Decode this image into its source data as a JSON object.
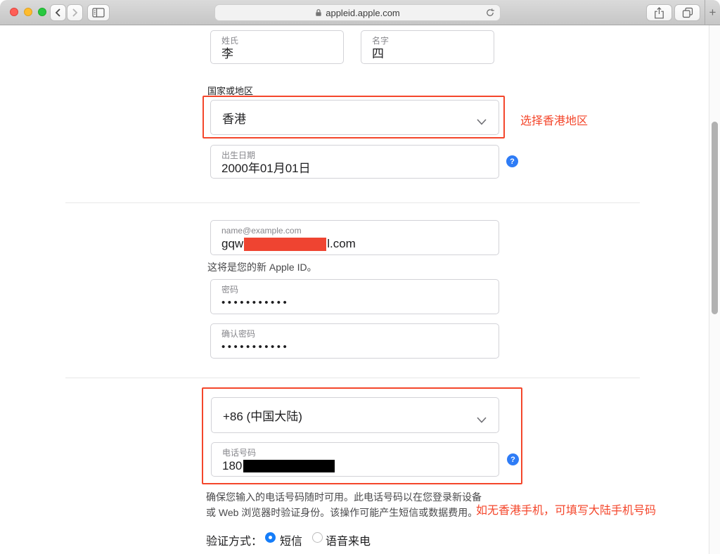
{
  "browser": {
    "url": "appleid.apple.com",
    "new_tab": "+"
  },
  "ui": {
    "help_glyph": "?"
  },
  "form": {
    "last_name": {
      "label": "姓氏",
      "value": "李"
    },
    "first_name": {
      "label": "名字",
      "value": "四"
    },
    "region_label": "国家或地区",
    "region_value": "香港",
    "birthday": {
      "label": "出生日期",
      "value": "2000年01月01日"
    },
    "email": {
      "placeholder": "name@example.com",
      "value_prefix": "gqw",
      "value_suffix": "l.com"
    },
    "email_note": "这将是您的新 Apple ID。",
    "password": {
      "label": "密码",
      "value": "•••••••••••"
    },
    "confirm_password": {
      "label": "确认密码",
      "value": "•••••••••••"
    },
    "phone_country_value": "+86 (中国大陆)",
    "phone": {
      "label": "电话号码",
      "value_prefix": "180"
    },
    "phone_note1": "确保您输入的电话号码随时可用。此电话号码以在您登录新设备",
    "phone_note2": "或 Web 浏览器时验证身份。该操作可能产生短信或数据费用。",
    "verification": {
      "label": "验证方式：",
      "options": [
        {
          "label": "短信",
          "selected": true
        },
        {
          "label": "语音来电",
          "selected": false
        }
      ]
    }
  },
  "annotations": {
    "region_tip": "选择香港地区",
    "phone_tip": "如无香港手机，可填写大陆手机号码",
    "accent_color": "#f4462b"
  }
}
